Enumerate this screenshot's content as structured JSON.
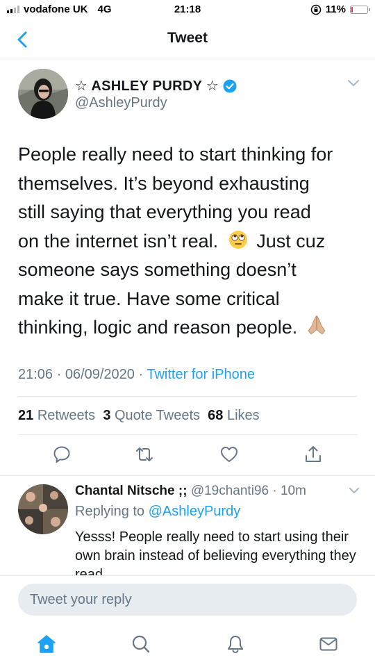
{
  "status_bar": {
    "carrier": "vodafone UK",
    "network": "4G",
    "time": "21:18",
    "battery_percent": "11%",
    "battery_level": 0.11
  },
  "header": {
    "title": "Tweet"
  },
  "tweet": {
    "author_name": "☆ ASHLEY PURDY ☆",
    "handle": "@AshleyPurdy",
    "text_lines": [
      "People really need to start thinking for",
      "themselves. It’s beyond exhausting",
      "still saying that everything you read",
      "on the internet isn’t real.",
      "Just cuz",
      "someone says something doesn’t",
      "make it true. Have some critical",
      "thinking, logic and reason people."
    ],
    "emoji_1": "face-with-rolling-eyes",
    "emoji_2": "folded-hands",
    "time": "21:06 · 06/09/2020 ·",
    "source": "Twitter for iPhone",
    "retweets_count": "21",
    "retweets_label": "Retweets",
    "quotes_count": "3",
    "quotes_label": "Quote Tweets",
    "likes_count": "68",
    "likes_label": "Likes"
  },
  "actions": [
    "reply-icon",
    "retweet-icon",
    "like-icon",
    "share-icon"
  ],
  "reply": {
    "name": "Chantal Nitsche ;;",
    "handle_time": "@19chanti96 · 10m",
    "replying_prefix": "Replying to",
    "replying_to": "@AshleyPurdy",
    "text": "Yesss! People really need to start using their own brain instead of believing everything they read"
  },
  "reply_input": {
    "placeholder": "Tweet your reply"
  },
  "tabbar": [
    "home-icon",
    "search-icon",
    "notifications-icon",
    "messages-icon"
  ],
  "colors": {
    "accent": "#1da1f2",
    "text": "#14171a",
    "secondary": "#657786",
    "divider": "#e6ecf0",
    "battery_low": "#e0245e"
  }
}
